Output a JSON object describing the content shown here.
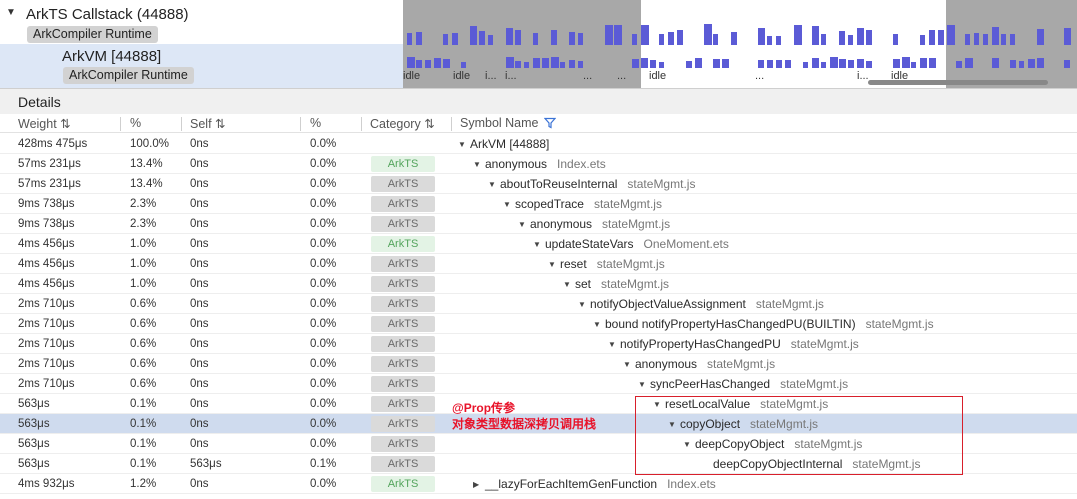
{
  "timeline": {
    "lanes": [
      {
        "title": "ArkTS Callstack (44888)",
        "tag": "ArkCompiler Runtime",
        "expanded": true
      },
      {
        "title": "ArkVM [44888]",
        "tag": "ArkCompiler Runtime"
      }
    ],
    "state_labels": [
      "idle",
      "idle",
      "i...",
      "i...",
      "...",
      "...",
      "idle",
      "...",
      "i...",
      "idle"
    ],
    "colors": {
      "bar": "#5b5bd6",
      "shade": "#a8a8a8",
      "selected_lane": "#dde7f6"
    }
  },
  "details": {
    "title": "Details",
    "columns": [
      "Weight",
      "%",
      "Self",
      "%",
      "Category",
      "Symbol Name"
    ],
    "sort_icon": "sort-arrows-icon",
    "filter_icon": "filter-icon",
    "rows": [
      {
        "weight": "428ms 475μs",
        "pct": "100.0%",
        "self": "0ns",
        "self_pct": "0.0%",
        "category": "",
        "cat_style": "none",
        "name": "ArkVM [44888]",
        "file": "",
        "expanded": true
      },
      {
        "weight": "57ms 231μs",
        "pct": "13.4%",
        "self": "0ns",
        "self_pct": "0.0%",
        "category": "ArkTS",
        "cat_style": "green",
        "name": "anonymous",
        "file": "Index.ets",
        "expanded": true
      },
      {
        "weight": "57ms 231μs",
        "pct": "13.4%",
        "self": "0ns",
        "self_pct": "0.0%",
        "category": "ArkTS",
        "cat_style": "gray",
        "name": "aboutToReuseInternal",
        "file": "stateMgmt.js",
        "expanded": true
      },
      {
        "weight": "9ms 738μs",
        "pct": "2.3%",
        "self": "0ns",
        "self_pct": "0.0%",
        "category": "ArkTS",
        "cat_style": "gray",
        "name": "scopedTrace",
        "file": "stateMgmt.js",
        "expanded": true
      },
      {
        "weight": "9ms 738μs",
        "pct": "2.3%",
        "self": "0ns",
        "self_pct": "0.0%",
        "category": "ArkTS",
        "cat_style": "gray",
        "name": "anonymous",
        "file": "stateMgmt.js",
        "expanded": true
      },
      {
        "weight": "4ms 456μs",
        "pct": "1.0%",
        "self": "0ns",
        "self_pct": "0.0%",
        "category": "ArkTS",
        "cat_style": "green",
        "name": "updateStateVars",
        "file": "OneMoment.ets",
        "expanded": true
      },
      {
        "weight": "4ms 456μs",
        "pct": "1.0%",
        "self": "0ns",
        "self_pct": "0.0%",
        "category": "ArkTS",
        "cat_style": "gray",
        "name": "reset",
        "file": "stateMgmt.js",
        "expanded": true
      },
      {
        "weight": "4ms 456μs",
        "pct": "1.0%",
        "self": "0ns",
        "self_pct": "0.0%",
        "category": "ArkTS",
        "cat_style": "gray",
        "name": "set",
        "file": "stateMgmt.js",
        "expanded": true
      },
      {
        "weight": "2ms 710μs",
        "pct": "0.6%",
        "self": "0ns",
        "self_pct": "0.0%",
        "category": "ArkTS",
        "cat_style": "gray",
        "name": "notifyObjectValueAssignment",
        "file": "stateMgmt.js",
        "expanded": true
      },
      {
        "weight": "2ms 710μs",
        "pct": "0.6%",
        "self": "0ns",
        "self_pct": "0.0%",
        "category": "ArkTS",
        "cat_style": "gray",
        "name": "bound notifyPropertyHasChangedPU(BUILTIN)",
        "file": "stateMgmt.js",
        "expanded": true
      },
      {
        "weight": "2ms 710μs",
        "pct": "0.6%",
        "self": "0ns",
        "self_pct": "0.0%",
        "category": "ArkTS",
        "cat_style": "gray",
        "name": "notifyPropertyHasChangedPU",
        "file": "stateMgmt.js",
        "expanded": true
      },
      {
        "weight": "2ms 710μs",
        "pct": "0.6%",
        "self": "0ns",
        "self_pct": "0.0%",
        "category": "ArkTS",
        "cat_style": "gray",
        "name": "anonymous",
        "file": "stateMgmt.js",
        "expanded": true
      },
      {
        "weight": "2ms 710μs",
        "pct": "0.6%",
        "self": "0ns",
        "self_pct": "0.0%",
        "category": "ArkTS",
        "cat_style": "gray",
        "name": "syncPeerHasChanged",
        "file": "stateMgmt.js",
        "expanded": true
      },
      {
        "weight": "563μs",
        "pct": "0.1%",
        "self": "0ns",
        "self_pct": "0.0%",
        "category": "ArkTS",
        "cat_style": "gray",
        "name": "resetLocalValue",
        "file": "stateMgmt.js",
        "expanded": true
      },
      {
        "weight": "563μs",
        "pct": "0.1%",
        "self": "0ns",
        "self_pct": "0.0%",
        "category": "ArkTS",
        "cat_style": "gray",
        "name": "copyObject",
        "file": "stateMgmt.js",
        "expanded": true,
        "selected": true
      },
      {
        "weight": "563μs",
        "pct": "0.1%",
        "self": "0ns",
        "self_pct": "0.0%",
        "category": "ArkTS",
        "cat_style": "gray",
        "name": "deepCopyObject",
        "file": "stateMgmt.js",
        "expanded": true
      },
      {
        "weight": "563μs",
        "pct": "0.1%",
        "self": "563μs",
        "self_pct": "0.1%",
        "category": "ArkTS",
        "cat_style": "gray",
        "name": "deepCopyObjectInternal",
        "file": "stateMgmt.js",
        "expanded": null
      },
      {
        "weight": "4ms 932μs",
        "pct": "1.2%",
        "self": "0ns",
        "self_pct": "0.0%",
        "category": "ArkTS",
        "cat_style": "green",
        "name": "__lazyForEachItemGenFunction",
        "file": "Index.ets",
        "expanded": false
      }
    ]
  },
  "annotation": {
    "line1": "@Prop传参",
    "line2": "对象类型数据深拷贝调用栈",
    "color": "#e8132a"
  }
}
